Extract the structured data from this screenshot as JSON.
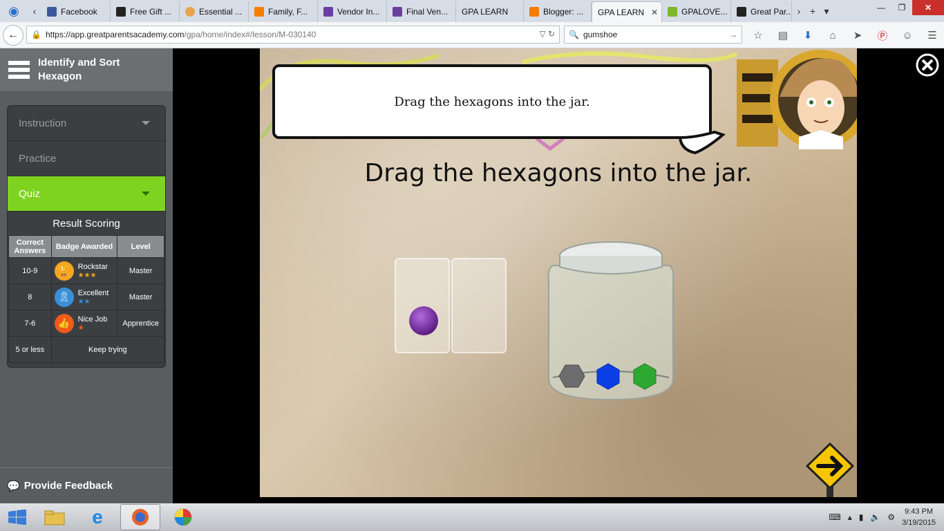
{
  "browser": {
    "tabs": [
      {
        "label": "Facebook",
        "color": "#3b5998"
      },
      {
        "label": "Free Gift ...",
        "color": "#222222"
      },
      {
        "label": "Essential ...",
        "color": "#e8a54b"
      },
      {
        "label": "Family, F...",
        "color": "#f57d00"
      },
      {
        "label": "Vendor In...",
        "color": "#6a3fa0"
      },
      {
        "label": "Final Ven...",
        "color": "#6a3fa0"
      },
      {
        "label": "GPA LEARN",
        "color": "#ffffff"
      },
      {
        "label": "Blogger: ...",
        "color": "#f57d00"
      },
      {
        "label": "GPA LEARN",
        "color": "#ffffff",
        "active": true
      },
      {
        "label": "GPALOVE...",
        "color": "#7db82f"
      },
      {
        "label": "Great Par...",
        "color": "#222222"
      }
    ],
    "url_host": "https://app.greatparentsacademy.com",
    "url_path": "/gpa/home/index#/lesson/M-030140",
    "search_value": "gumshoe"
  },
  "sidebar": {
    "title": "Identify and Sort Hexagon",
    "menu": [
      {
        "label": "Instruction",
        "active": false,
        "caret": true
      },
      {
        "label": "Practice",
        "active": false,
        "caret": false
      },
      {
        "label": "Quiz",
        "active": true,
        "caret": true
      }
    ],
    "result_title": "Result Scoring",
    "table_headers": [
      "Correct Answers",
      "Badge Awarded",
      "Level"
    ],
    "rows": [
      {
        "answers": "10-9",
        "badge": "Rockstar",
        "badge_color": "#f5a623",
        "stars": "★★★",
        "star_color": "#f5a623",
        "level": "Master"
      },
      {
        "answers": "8",
        "badge": "Excellent",
        "badge_color": "#3a8fd8",
        "stars": "★★",
        "star_color": "#3a8fd8",
        "level": "Master"
      },
      {
        "answers": "7-6",
        "badge": "Nice Job",
        "badge_color": "#f05a1a",
        "stars": "★",
        "star_color": "#f05a1a",
        "level": "Apprentice"
      },
      {
        "answers": "5 or less",
        "badge": "Keep trying",
        "level": ""
      }
    ],
    "feedback_label": "Provide Feedback"
  },
  "game": {
    "bubble_text": "Drag the hexagons into the jar.",
    "instruction_text": "Drag the hexagons into the jar.",
    "ball_color": "#7b2fa0",
    "hexagon_colors": [
      "#6d6d6d",
      "#0b3fe6",
      "#2fa831"
    ]
  },
  "taskbar": {
    "time": "9:43 PM",
    "date": "3/19/2015"
  }
}
